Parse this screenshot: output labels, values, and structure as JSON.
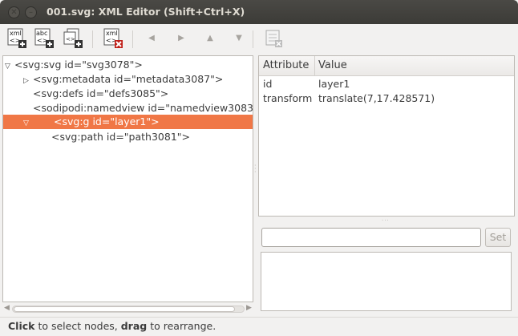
{
  "window": {
    "title": "001.svg: XML Editor (Shift+Ctrl+X)"
  },
  "toolbar": {
    "new_element_label": "xml",
    "new_text_label": "abc",
    "delete_label": "xml",
    "icons": [
      "new-element-node-icon",
      "new-text-node-icon",
      "duplicate-node-icon",
      "delete-node-icon",
      "unindent-arrow-icon",
      "indent-arrow-icon",
      "raise-arrow-icon",
      "lower-arrow-icon",
      "delete-attribute-icon"
    ]
  },
  "tree": {
    "nodes": [
      {
        "label": "<svg:svg id=\"svg3078\">",
        "expander": "▽",
        "depth": 0,
        "selected": false
      },
      {
        "label": "<svg:metadata id=\"metadata3087\">",
        "expander": "▷",
        "depth": 1,
        "selected": false
      },
      {
        "label": "<svg:defs id=\"defs3085\">",
        "expander": "",
        "depth": 1,
        "selected": false
      },
      {
        "label": "<sodipodi:namedview id=\"namedview3083",
        "expander": "",
        "depth": 1,
        "selected": false
      },
      {
        "label": "<svg:g id=\"layer1\">",
        "expander": "▽",
        "depth": 1,
        "selected": true
      },
      {
        "label": "<svg:path id=\"path3081\">",
        "expander": "",
        "depth": 2,
        "selected": false
      }
    ]
  },
  "attributes": {
    "header_attribute": "Attribute",
    "header_value": "Value",
    "rows": [
      {
        "name": "id",
        "value": "layer1"
      },
      {
        "name": "transform",
        "value": "translate(7,17.428571)"
      }
    ]
  },
  "editor": {
    "value_input": "",
    "set_label": "Set"
  },
  "status": {
    "b1": "Click",
    "t1": " to select nodes, ",
    "b2": "drag",
    "t2": " to rearrange."
  },
  "colors": {
    "selection": "#f07746",
    "titlebar": "#3c3b37"
  }
}
